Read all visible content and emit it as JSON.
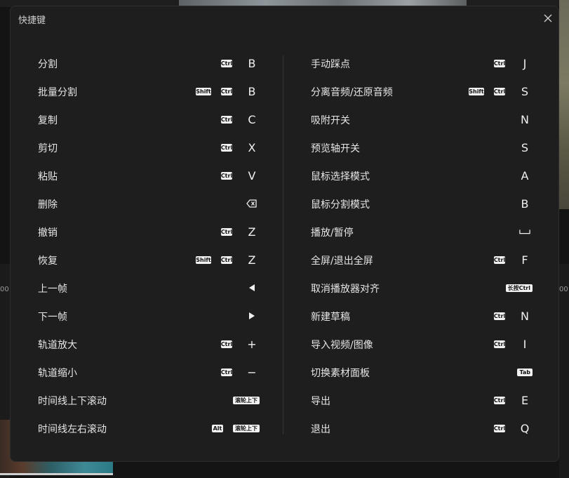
{
  "dialog": {
    "title": "快捷键",
    "close_icon": "close-icon"
  },
  "left_items": [
    {
      "label": "分割",
      "keys": [
        "Ctrl"
      ],
      "main": "B"
    },
    {
      "label": "批量分割",
      "keys": [
        "Shift",
        "Ctrl"
      ],
      "main": "B"
    },
    {
      "label": "复制",
      "keys": [
        "Ctrl"
      ],
      "main": "C"
    },
    {
      "label": "剪切",
      "keys": [
        "Ctrl"
      ],
      "main": "X"
    },
    {
      "label": "粘贴",
      "keys": [
        "Ctrl"
      ],
      "main": "V"
    },
    {
      "label": "删除",
      "keys": [],
      "main_icon": "backspace-icon"
    },
    {
      "label": "撤销",
      "keys": [
        "Ctrl"
      ],
      "main": "Z"
    },
    {
      "label": "恢复",
      "keys": [
        "Shift",
        "Ctrl"
      ],
      "main": "Z"
    },
    {
      "label": "上一帧",
      "keys": [],
      "main_icon": "arrow-left-icon"
    },
    {
      "label": "下一帧",
      "keys": [],
      "main_icon": "arrow-right-icon"
    },
    {
      "label": "轨道放大",
      "keys": [
        "Ctrl"
      ],
      "main": "+"
    },
    {
      "label": "轨道缩小",
      "keys": [
        "Ctrl"
      ],
      "main": "−"
    },
    {
      "label": "时间线上下滚动",
      "keys": [
        "滚轮上下"
      ],
      "main": ""
    },
    {
      "label": "时间线左右滚动",
      "keys": [
        "Alt",
        "滚轮上下"
      ],
      "main": ""
    }
  ],
  "right_items": [
    {
      "label": "手动踩点",
      "keys": [
        "Ctrl"
      ],
      "main": "J"
    },
    {
      "label": "分离音频/还原音频",
      "keys": [
        "Shift",
        "Ctrl"
      ],
      "main": "S"
    },
    {
      "label": "吸附开关",
      "keys": [],
      "main": "N"
    },
    {
      "label": "预览轴开关",
      "keys": [],
      "main": "S"
    },
    {
      "label": "鼠标选择模式",
      "keys": [],
      "main": "A"
    },
    {
      "label": "鼠标分割模式",
      "keys": [],
      "main": "B"
    },
    {
      "label": "播放/暂停",
      "keys": [],
      "main_icon": "space-icon"
    },
    {
      "label": "全屏/退出全屏",
      "keys": [
        "Ctrl"
      ],
      "main": "F"
    },
    {
      "label": "取消播放器对齐",
      "keys": [
        "长按Ctrl"
      ],
      "main": ""
    },
    {
      "label": "新建草稿",
      "keys": [
        "Ctrl"
      ],
      "main": "N"
    },
    {
      "label": "导入视频/图像",
      "keys": [
        "Ctrl"
      ],
      "main": "I"
    },
    {
      "label": "切换素材面板",
      "keys": [
        "Tab"
      ],
      "main": ""
    },
    {
      "label": "导出",
      "keys": [
        "Ctrl"
      ],
      "main": "E"
    },
    {
      "label": "退出",
      "keys": [
        "Ctrl"
      ],
      "main": "Q"
    }
  ],
  "background": {
    "ruler_left": "00",
    "ruler_right": "00"
  }
}
